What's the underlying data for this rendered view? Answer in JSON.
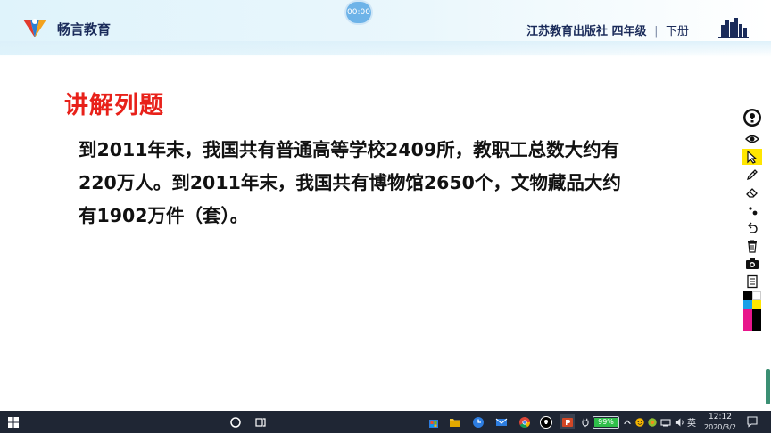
{
  "header": {
    "brand": "畅言教育",
    "publisher": "江苏教育出版社",
    "grade": "四年级",
    "volume": "下册",
    "separator": "|"
  },
  "timer": {
    "label": "00:00"
  },
  "slide": {
    "title": "讲解列题",
    "lines": [
      "到2011年末，我国共有普通高等学校2409所，教职工总数大约有",
      "220万人。到2011年末，我国共有博物馆2650个，文物藏品大约",
      "有1902万件（套）。"
    ]
  },
  "toolbar": {
    "tools": [
      "power-icon",
      "eye-icon",
      "pointer-icon",
      "pen-icon",
      "eraser-icon",
      "dots-icon",
      "undo-icon",
      "trash-icon",
      "camera-icon",
      "document-icon"
    ],
    "active_tool": "pointer-icon",
    "palette": [
      "#000000",
      "#ffffff",
      "#1aa0e8",
      "#ffe600",
      "#e8168c",
      "#000000"
    ]
  },
  "taskbar": {
    "battery": "99%",
    "battery_level": 0.99,
    "language": "英",
    "time": "12:12",
    "date": "2020/3/2"
  },
  "colors": {
    "title_red": "#e8211a",
    "brand_navy": "#1a2b5a",
    "taskbar_bg": "#1f2634"
  }
}
